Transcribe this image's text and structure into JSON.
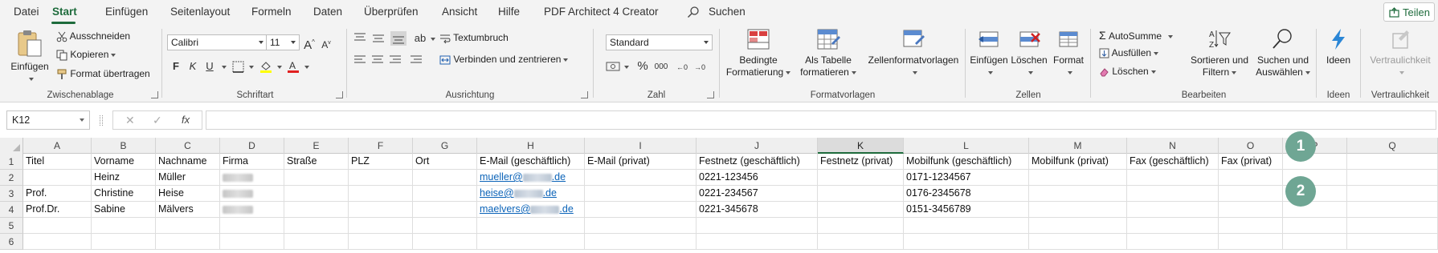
{
  "menu": {
    "tabs": [
      "Datei",
      "Start",
      "Einfügen",
      "Seitenlayout",
      "Formeln",
      "Daten",
      "Überprüfen",
      "Ansicht",
      "Hilfe",
      "PDF Architect 4 Creator"
    ],
    "search_label": "Suchen",
    "share_label": "Teilen"
  },
  "ribbon": {
    "clipboard": {
      "paste": "Einfügen",
      "cut": "Ausschneiden",
      "copy": "Kopieren",
      "format_painter": "Format übertragen",
      "label": "Zwischenablage"
    },
    "font": {
      "font_name": "Calibri",
      "font_size": "11",
      "bold": "F",
      "italic": "K",
      "underline": "U",
      "label": "Schriftart"
    },
    "alignment": {
      "wrap_text": "Textumbruch",
      "merge_center": "Verbinden und zentrieren",
      "label": "Ausrichtung"
    },
    "number": {
      "format": "Standard",
      "percent": "%",
      "thousands": "000",
      "label": "Zahl"
    },
    "styles": {
      "conditional_line1": "Bedingte",
      "conditional_line2": "Formatierung",
      "table_line1": "Als Tabelle",
      "table_line2": "formatieren",
      "cell_styles": "Zellenformatvorlagen",
      "label": "Formatvorlagen"
    },
    "cells": {
      "insert": "Einfügen",
      "delete": "Löschen",
      "format": "Format",
      "label": "Zellen"
    },
    "editing": {
      "autosum": "AutoSumme",
      "fill": "Ausfüllen",
      "clear": "Löschen",
      "sort_line1": "Sortieren und",
      "sort_line2": "Filtern",
      "find_line1": "Suchen und",
      "find_line2": "Auswählen",
      "label": "Bearbeiten"
    },
    "ideas": {
      "button": "Ideen",
      "label": "Ideen"
    },
    "sensitivity": {
      "button": "Vertraulichkeit",
      "label": "Vertraulichkeit"
    }
  },
  "formula_bar": {
    "name_box": "K12",
    "fx": "fx",
    "formula": ""
  },
  "sheet": {
    "columns": [
      "A",
      "B",
      "C",
      "D",
      "E",
      "F",
      "G",
      "H",
      "I",
      "J",
      "K",
      "L",
      "M",
      "N",
      "O",
      "P",
      "Q"
    ],
    "selected_column": "K",
    "rows": [
      "1",
      "2",
      "3",
      "4",
      "5",
      "6"
    ],
    "headers": [
      "Titel",
      "Vorname",
      "Nachname",
      "Firma",
      "Straße",
      "PLZ",
      "Ort",
      "E-Mail (geschäftlich)",
      "E-Mail (privat)",
      "Festnetz (geschäftlich)",
      "Festnetz (privat)",
      "Mobilfunk (geschäftlich)",
      "Mobilfunk (privat)",
      "Fax (geschäftlich)",
      "Fax (privat)"
    ],
    "data": [
      {
        "titel": "",
        "vorname": "Heinz",
        "nachname": "Müller",
        "email_prefix": "mueller@",
        "email_suffix": ".de",
        "festnetz": "0221-123456",
        "mobil": "0171-1234567"
      },
      {
        "titel": "Prof.",
        "vorname": "Christine",
        "nachname": "Heise",
        "email_prefix": "heise@",
        "email_suffix": ".de",
        "festnetz": "0221-234567",
        "mobil": "0176-2345678"
      },
      {
        "titel": "Prof.Dr.",
        "vorname": "Sabine",
        "nachname": "Mälvers",
        "email_prefix": "maelvers@",
        "email_suffix": ".de",
        "festnetz": "0221-345678",
        "mobil": "0151-3456789"
      }
    ]
  },
  "annotations": [
    "1",
    "2"
  ],
  "colors": {
    "accent": "#1e6b3c",
    "link": "#0b63b8",
    "badge": "#6fa694"
  }
}
